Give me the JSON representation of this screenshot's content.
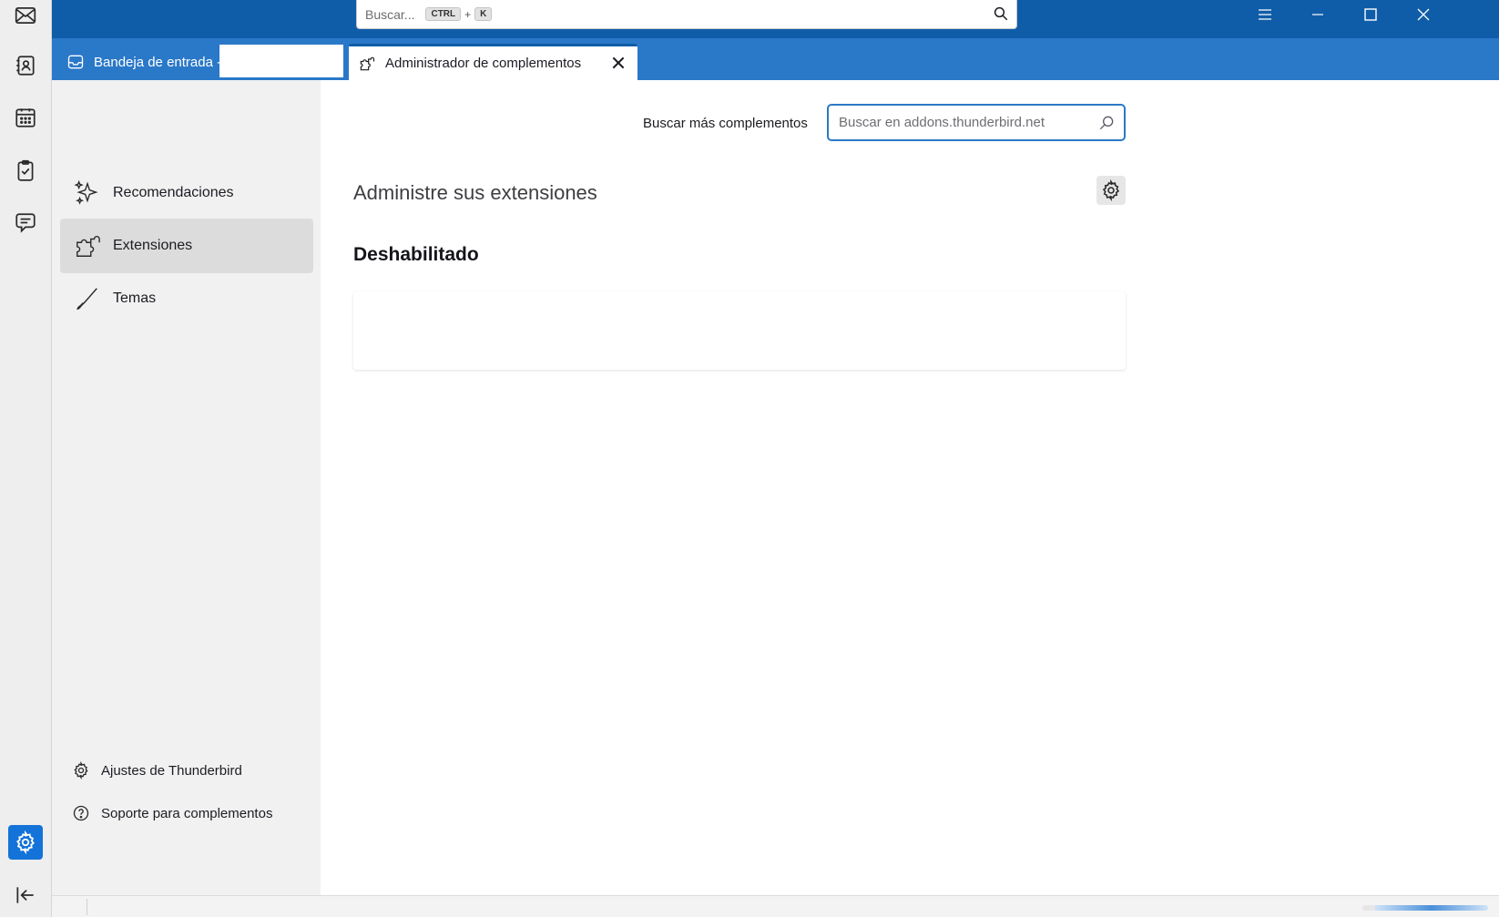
{
  "global_search": {
    "placeholder": "Buscar...",
    "shortcut_key1": "CTRL",
    "shortcut_plus": "+",
    "shortcut_key2": "K"
  },
  "spaces": [
    {
      "id": "mail",
      "icon": "mail-icon"
    },
    {
      "id": "address-book",
      "icon": "address-book-icon"
    },
    {
      "id": "calendar",
      "icon": "calendar-icon"
    },
    {
      "id": "tasks",
      "icon": "tasks-icon"
    },
    {
      "id": "chat",
      "icon": "chat-icon"
    },
    {
      "id": "settings",
      "icon": "settings-gear-icon",
      "active": true
    },
    {
      "id": "collapse",
      "icon": "collapse-arrow-icon"
    }
  ],
  "tabs": [
    {
      "label": "Bandeja de entrada -",
      "icon": "inbox-icon"
    },
    {
      "label": "Administrador de complementos",
      "icon": "puzzle-icon",
      "selected": true
    }
  ],
  "sidebar": {
    "categories": [
      {
        "label": "Recomendaciones",
        "icon": "sparkle-icon"
      },
      {
        "label": "Extensiones",
        "icon": "puzzle-icon",
        "selected": true
      },
      {
        "label": "Temas",
        "icon": "brush-icon"
      }
    ],
    "footer": [
      {
        "label": "Ajustes de Thunderbird",
        "icon": "gear-icon"
      },
      {
        "label": "Soporte para complementos",
        "icon": "help-icon"
      }
    ]
  },
  "main": {
    "search_label": "Buscar más complementos",
    "search_placeholder": "Buscar en addons.thunderbird.net",
    "heading": "Administre sus extensiones",
    "section_title": "Deshabilitado"
  },
  "colors": {
    "titlebar": "#0f5da8",
    "tabbar": "#2a78c8",
    "accent": "#1373d9"
  }
}
